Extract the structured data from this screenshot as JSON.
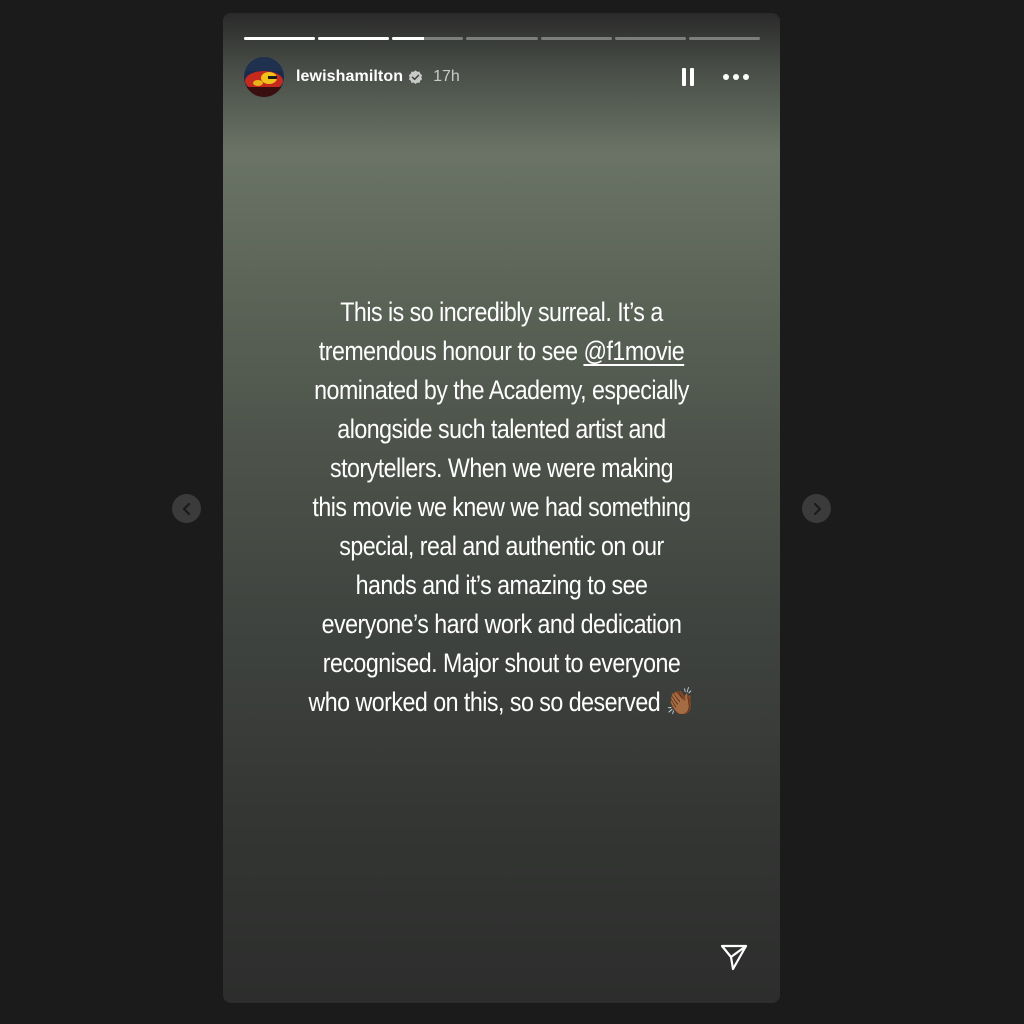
{
  "story": {
    "username": "lewishamilton",
    "verified": true,
    "time_ago": "17h",
    "progress": {
      "segments": 7,
      "completed": 2,
      "current_fraction": 0.45
    },
    "caption_lines": [
      "This is so incredibly surreal. It’s a",
      "tremendous honour to see ",
      "nominated by the Academy, especially",
      "alongside such talented artist and",
      "storytellers. When we were making",
      "this movie we knew we had something",
      "special, real and authentic on our",
      "hands and it’s amazing to see",
      "everyone’s hard work and dedication",
      "recognised. Major shout to everyone",
      "who worked on this, so so deserved "
    ],
    "mention": "@f1movie",
    "emoji": "👏🏾"
  },
  "icons": {
    "pause": "pause-icon",
    "more": "more-options-icon",
    "share": "send-icon",
    "prev": "chevron-left-icon",
    "next": "chevron-right-icon",
    "verified": "verified-badge-icon"
  },
  "colors": {
    "page_background": "#1b1b1b",
    "verified_blue": "#3897f0",
    "text": "#ffffff"
  }
}
